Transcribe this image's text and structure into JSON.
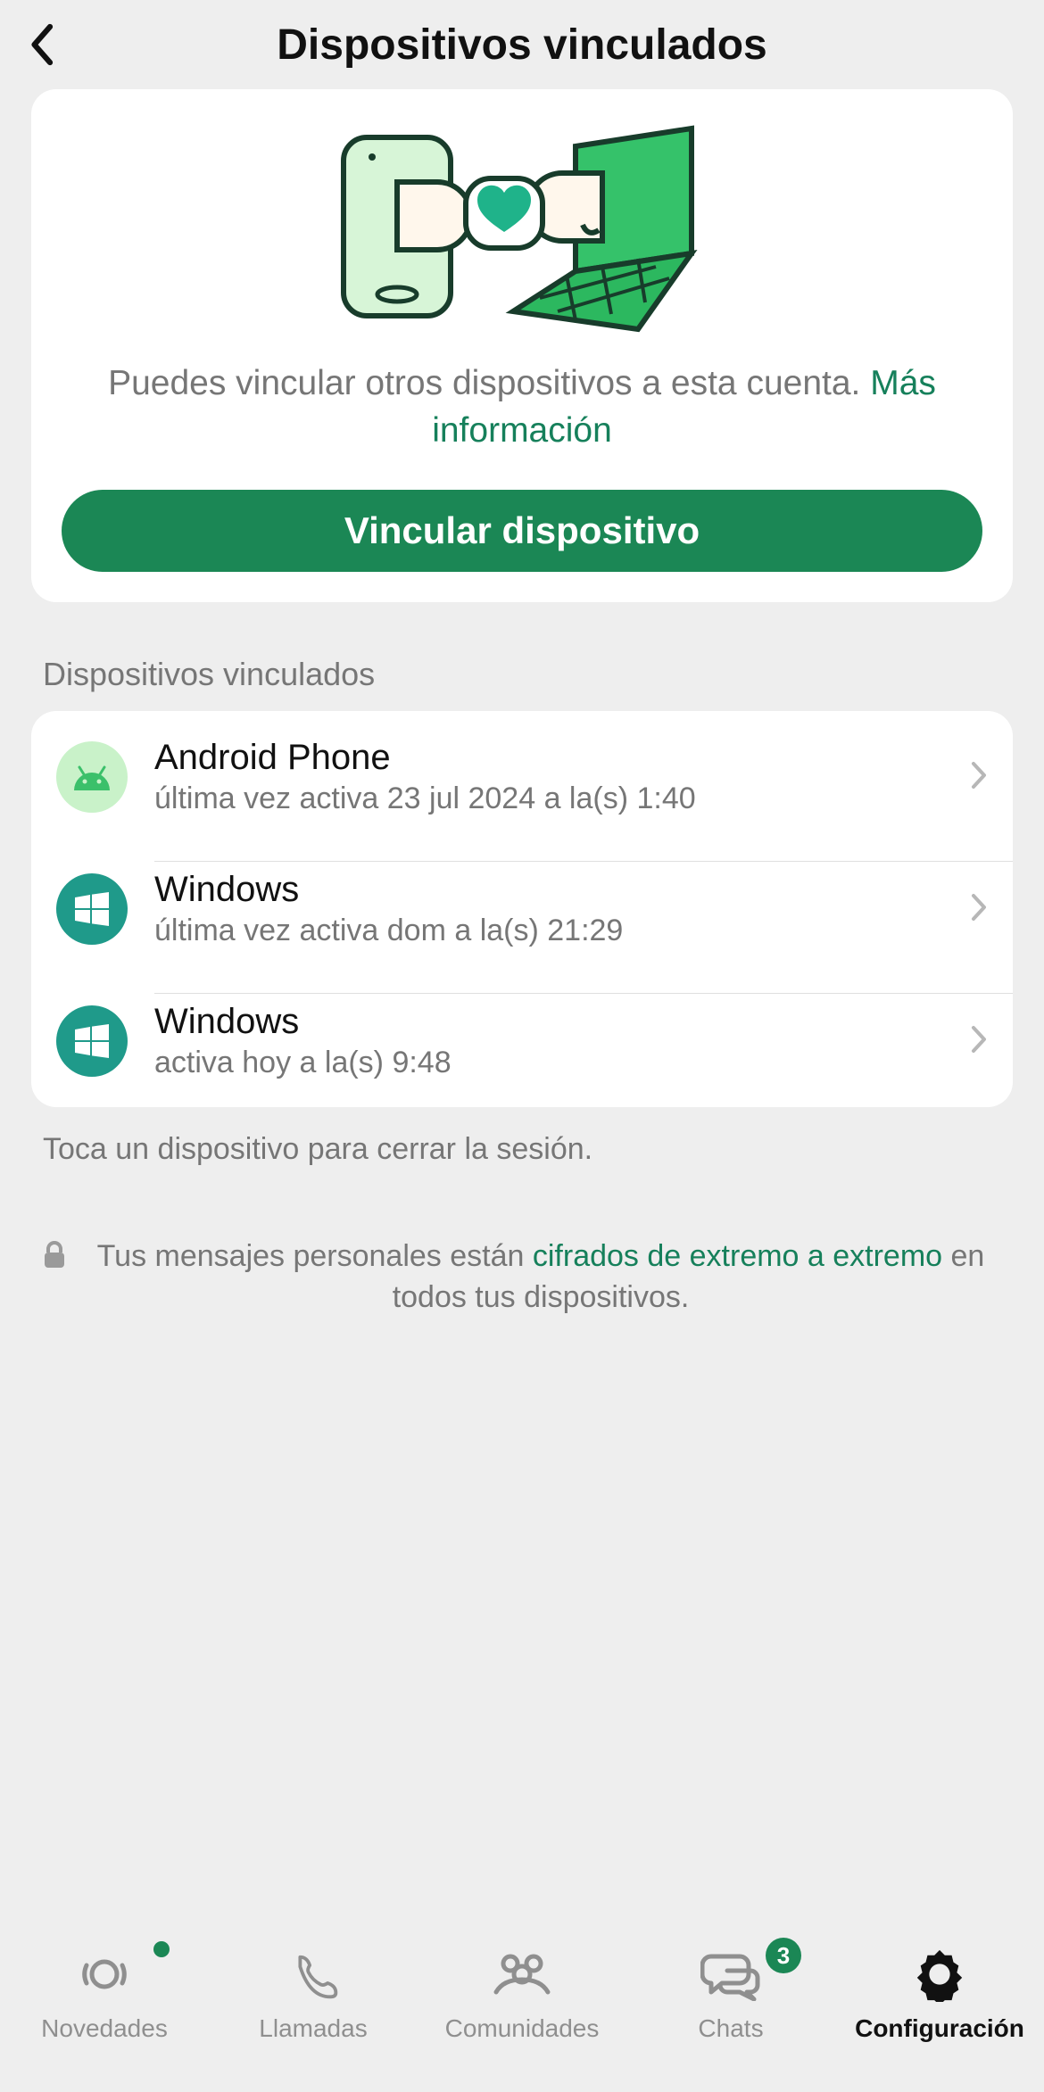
{
  "header": {
    "title": "Dispositivos vinculados"
  },
  "hero": {
    "text_prefix": "Puedes vincular otros dispositivos a esta cuenta. ",
    "learn_more": "Más información",
    "button": "Vincular dispositivo"
  },
  "section": {
    "title": "Dispositivos vinculados"
  },
  "devices": [
    {
      "name": "Android Phone",
      "status": "última vez activa 23 jul 2024 a la(s) 1:40",
      "icon": "android"
    },
    {
      "name": "Windows",
      "status": "última vez activa dom a la(s) 21:29",
      "icon": "windows"
    },
    {
      "name": "Windows",
      "status": "activa hoy a la(s) 9:48",
      "icon": "windows"
    }
  ],
  "hint": "Toca un dispositivo para cerrar la sesión.",
  "e2e": {
    "prefix": "Tus mensajes personales están ",
    "link": "cifrados de extremo a extremo",
    "suffix": " en todos tus dispositivos."
  },
  "tabs": [
    {
      "key": "novedades",
      "label": "Novedades",
      "dot": true
    },
    {
      "key": "llamadas",
      "label": "Llamadas"
    },
    {
      "key": "comunidades",
      "label": "Comunidades"
    },
    {
      "key": "chats",
      "label": "Chats",
      "badge": "3"
    },
    {
      "key": "configuracion",
      "label": "Configuración",
      "active": true
    }
  ]
}
